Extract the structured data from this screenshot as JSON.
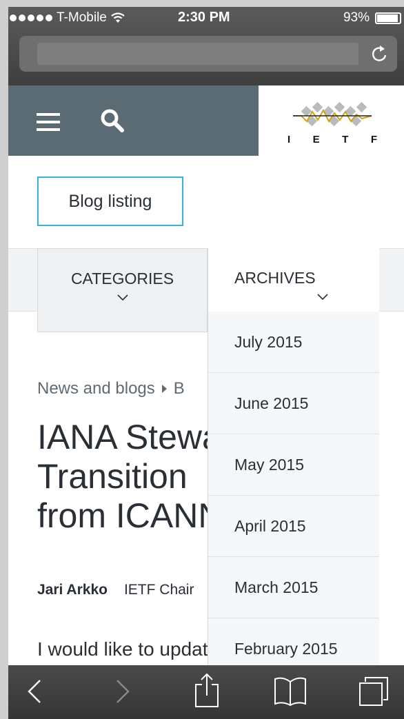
{
  "statusbar": {
    "carrier": "T-Mobile",
    "time": "2:30 PM",
    "battery": "93%",
    "battery_level": 0.93
  },
  "browser": {
    "url_text": "",
    "icons": [
      "reload-icon",
      "back-icon",
      "forward-icon",
      "share-icon",
      "bookmarks-icon",
      "tabs-icon"
    ]
  },
  "header": {
    "logo_text": "IETF",
    "logo_letters": [
      "I",
      "E",
      "T",
      "F"
    ],
    "icons": [
      "menu-icon",
      "search-icon"
    ]
  },
  "blog_button": {
    "label": "Blog listing"
  },
  "filters": {
    "categories": "CATEGORIES",
    "archives": "ARCHIVES"
  },
  "archives_menu": [
    "July 2015",
    "June 2015",
    "May 2015",
    "April 2015",
    "March 2015",
    "February 2015"
  ],
  "breadcrumb": {
    "item1": "News and blogs",
    "item2": "B"
  },
  "article": {
    "title": "IANA Stewardship\nTransition\nfrom ICANN",
    "author": "Jari Arkko",
    "author_role": "IETF Chair",
    "lead": "I would like to update"
  },
  "colors": {
    "header_slate": "#5b6b74",
    "accent_blue": "#3ab3de",
    "logo_gold": "#d4a017"
  }
}
